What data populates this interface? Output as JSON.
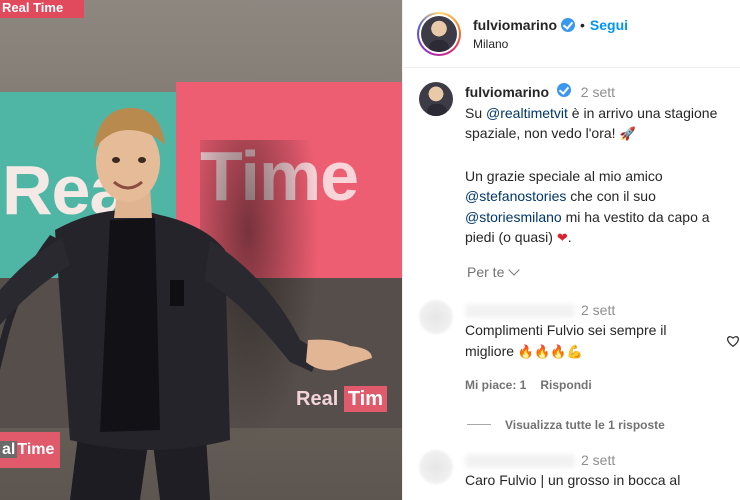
{
  "photo": {
    "banner_top": "Real Time",
    "wall_real": "Real",
    "wall_time": "Time",
    "lower_banner_real": "Real",
    "lower_banner_time": "Tim",
    "left_banner_real": "al",
    "left_banner_time": "Time"
  },
  "header": {
    "username": "fulviomarino",
    "separator": "•",
    "follow": "Segui",
    "location": "Milano"
  },
  "caption": {
    "username": "fulviomarino",
    "time": "2 sett",
    "line1_pre": "Su ",
    "mention1": "@realtimetvit",
    "line1_post": " è in arrivo una stagione spaziale, non vedo l'ora! ",
    "emoji_rocket": "🚀",
    "line2_pre": "Un grazie speciale al mio amico ",
    "mention2": "@stefanostories",
    "line2_mid": " che con il suo ",
    "mention3": "@storiesmilano",
    "line2_post": " mi ha vestito da capo a piedi (o quasi) ",
    "emoji_heart": "❤",
    "line2_end": ".",
    "see_translation": "Per te"
  },
  "comments": [
    {
      "time": "2 sett",
      "text": "Complimenti Fulvio sei sempre il migliore ",
      "emojis": "🔥🔥🔥💪",
      "likes": "Mi piace: 1",
      "reply": "Rispondi",
      "view_replies": "Visualizza tutte le 1 risposte"
    },
    {
      "time": "2 sett",
      "text": "Caro Fulvio | un grosso in bocca al"
    }
  ]
}
